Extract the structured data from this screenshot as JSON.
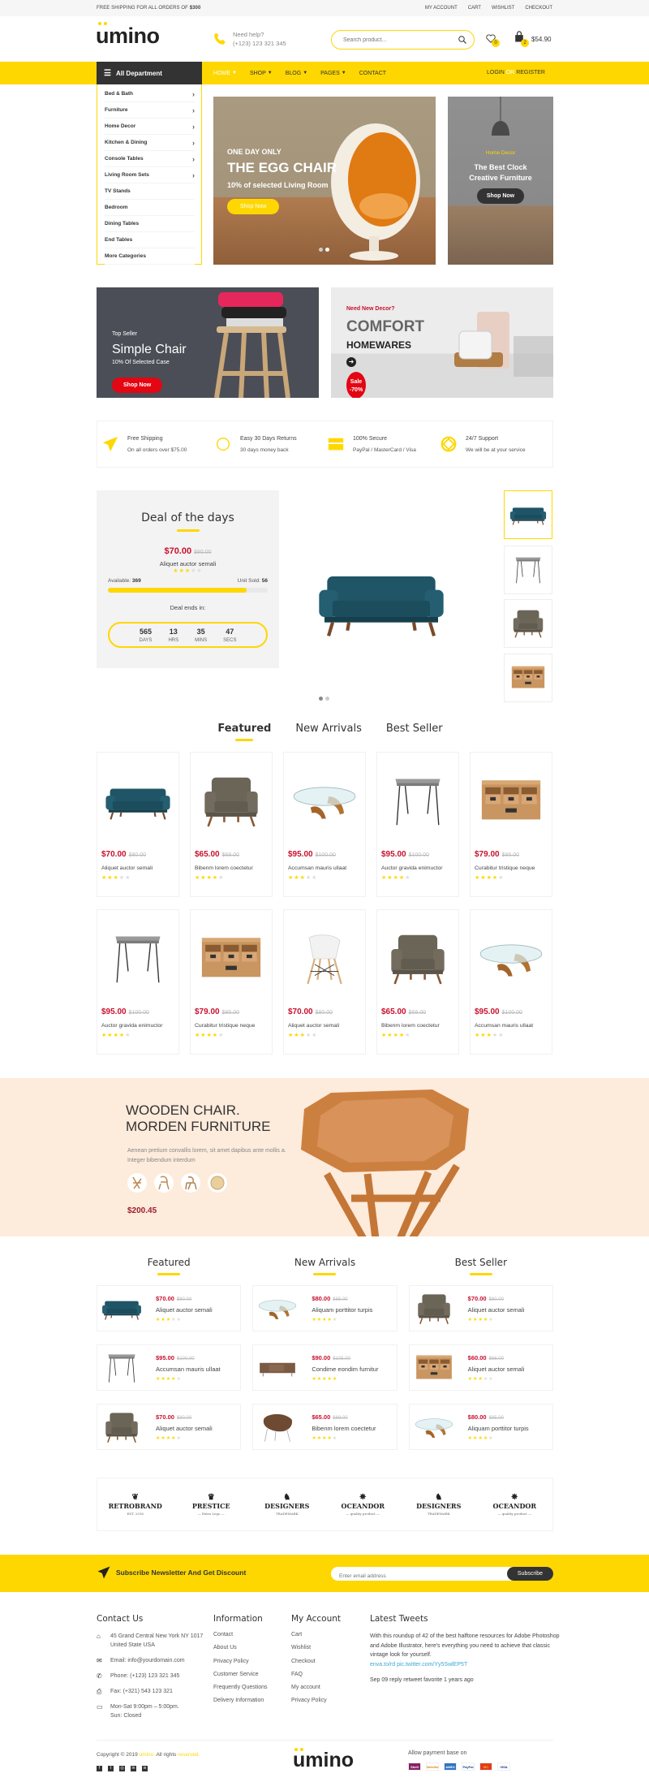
{
  "colors": {
    "accent": "#fed700",
    "price": "#c8102e",
    "dark": "#333333",
    "promo_bg": "#fdebdc"
  },
  "topbar": {
    "shipping_text": "FREE SHIPPING FOR ALL ORDERS OF",
    "shipping_amount": "$300",
    "links": [
      "MY ACCOUNT",
      "CART",
      "WISHLIST",
      "CHECKOUT"
    ]
  },
  "header": {
    "logo": "umino",
    "help_label": "Need help?",
    "phone": "(+123) 123 321 345",
    "search_placeholder": "Search product...",
    "wishlist_count": "0",
    "cart_count": "2",
    "cart_total": "$54.90"
  },
  "nav": {
    "department_label": "All Department",
    "items": [
      "HOME",
      "SHOP",
      "BLOG",
      "PAGES",
      "CONTACT"
    ],
    "active": "HOME",
    "login": "LOGIN",
    "or": "OR",
    "register": "REGISTER"
  },
  "departments": [
    {
      "label": "Bed & Bath",
      "arrow": true
    },
    {
      "label": "Furniture",
      "arrow": true
    },
    {
      "label": "Home Decor",
      "arrow": true
    },
    {
      "label": "Kitchen & Dining",
      "arrow": true
    },
    {
      "label": "Console Tables",
      "arrow": true
    },
    {
      "label": "Living Room Sets",
      "arrow": true
    },
    {
      "label": "TV Stands",
      "arrow": false
    },
    {
      "label": "Bedroom",
      "arrow": false
    },
    {
      "label": "Dining Tables",
      "arrow": false
    },
    {
      "label": "End Tables",
      "arrow": false
    },
    {
      "label": "More Categories",
      "arrow": false
    }
  ],
  "hero": {
    "eyebrow": "ONE DAY ONLY",
    "title": "THE EGG CHAIR",
    "subtitle": "10% of selected Living Room",
    "button": "Shop Now",
    "slides": 2,
    "active_slide": 2
  },
  "side_banner": {
    "eyebrow": "Home Decor",
    "title": "The Best Clock Creative Furniture",
    "button": "Shop Now"
  },
  "banners": {
    "left": {
      "eyebrow": "Top Seller",
      "title": "Simple Chair",
      "subtitle": "10% Of Selected Case",
      "button": "Shop Now"
    },
    "right": {
      "eyebrow": "Need New Decor?",
      "title": "COMFORT",
      "subtitle": "HOMEWARES",
      "sale": "Sale",
      "sale_value": "-70%"
    }
  },
  "features": [
    {
      "icon": "paper-plane-icon",
      "title": "Free Shipping",
      "text": "On all orders over $75.00"
    },
    {
      "icon": "return-icon",
      "title": "Easy 30 Days Returns",
      "text": "30 days money back"
    },
    {
      "icon": "credit-card-icon",
      "title": "100% Secure",
      "text": "PayPal / MasterCard / Visa"
    },
    {
      "icon": "lifebuoy-icon",
      "title": "24/7 Support",
      "text": "We will be at your service"
    }
  ],
  "deal": {
    "title": "Deal of the days",
    "price": "$70.00",
    "old_price": "$80.00",
    "name": "Aliquet auctor semali",
    "rating": 3,
    "available_label": "Available:",
    "available": "369",
    "sold_label": "Unit Sold:",
    "sold": "56",
    "progress": 0.87,
    "ends_label": "Deal ends in:",
    "countdown": [
      {
        "value": "565",
        "unit": "DAYS"
      },
      {
        "value": "13",
        "unit": "HRS"
      },
      {
        "value": "35",
        "unit": "MINS"
      },
      {
        "value": "47",
        "unit": "SECS"
      }
    ],
    "thumbnails": [
      "sofa",
      "side-table",
      "armchair",
      "cabinet"
    ],
    "active_thumbnail": 0
  },
  "tabs": {
    "items": [
      "Featured",
      "New Arrivals",
      "Best Seller"
    ],
    "active": 0
  },
  "products": {
    "items": [
      {
        "image": "sofa",
        "price": "$70.00",
        "old_price": "$80.00",
        "name": "Aliquet auctor semali",
        "rating": 3
      },
      {
        "image": "armchair",
        "price": "$65.00",
        "old_price": "$68.00",
        "name": "Bibenm lorem coectetur",
        "rating": 4
      },
      {
        "image": "coffee-table",
        "price": "$95.00",
        "old_price": "$100.00",
        "name": "Accumsan mauris ullaat",
        "rating": 3
      },
      {
        "image": "side-table",
        "price": "$95.00",
        "old_price": "$100.00",
        "name": "Auctor gravida enimuctor",
        "rating": 4
      },
      {
        "image": "cabinet",
        "price": "$79.00",
        "old_price": "$85.00",
        "name": "Curabitur tristique neque",
        "rating": 4
      },
      {
        "image": "side-table",
        "price": "$95.00",
        "old_price": "$100.00",
        "name": "Auctor gravida enimuctor",
        "rating": 4
      },
      {
        "image": "cabinet",
        "price": "$79.00",
        "old_price": "$85.00",
        "name": "Curabitur tristique neque",
        "rating": 4
      },
      {
        "image": "eames-chair",
        "price": "$70.00",
        "old_price": "$80.00",
        "name": "Aliquet auctor semali",
        "rating": 3
      },
      {
        "image": "armchair",
        "price": "$65.00",
        "old_price": "$68.00",
        "name": "Bibenm lorem coectetur",
        "rating": 4
      },
      {
        "image": "coffee-table",
        "price": "$95.00",
        "old_price": "$100.00",
        "name": "Accumsan mauris ullaat",
        "rating": 3
      }
    ]
  },
  "promo": {
    "title_line1": "WOODEN CHAIR.",
    "title_line2": "MORDEN FURNITURE",
    "text": "Aenean pretium convallis lorem, sit amet dapibus ante mollis a. Integer bibendum interdum",
    "price": "$200.45"
  },
  "lists": [
    {
      "title": "Featured",
      "items": [
        {
          "image": "sofa",
          "price": "$70.00",
          "old_price": "$80.00",
          "name": "Aliquet auctor semali",
          "rating": 3
        },
        {
          "image": "side-table",
          "price": "$95.00",
          "old_price": "$100.00",
          "name": "Accumsan mauris ullaat",
          "rating": 4
        },
        {
          "image": "armchair",
          "price": "$70.00",
          "old_price": "$80.00",
          "name": "Aliquet auctor semali",
          "rating": 4
        }
      ]
    },
    {
      "title": "New Arrivals",
      "items": [
        {
          "image": "coffee-table",
          "price": "$80.00",
          "old_price": "$85.00",
          "name": "Aliquam porttitor turpis",
          "rating": 4
        },
        {
          "image": "sideboard",
          "price": "$90.00",
          "old_price": "$105.00",
          "name": "Condime eondim furnitur",
          "rating": 5
        },
        {
          "image": "lounge-chair",
          "price": "$65.00",
          "old_price": "$68.00",
          "name": "Bibenm lorem coectetur",
          "rating": 4
        }
      ]
    },
    {
      "title": "Best Seller",
      "items": [
        {
          "image": "armchair",
          "price": "$70.00",
          "old_price": "$80.00",
          "name": "Aliquet auctor semali",
          "rating": 4
        },
        {
          "image": "cabinet",
          "price": "$60.00",
          "old_price": "$66.00",
          "name": "Aliquet auctor semali",
          "rating": 3
        },
        {
          "image": "coffee-table",
          "price": "$80.00",
          "old_price": "$85.00",
          "name": "Aliquam porttitor turpis",
          "rating": 4
        }
      ]
    }
  ],
  "brands": [
    {
      "name": "RETROBRAND",
      "mark": "❦",
      "tag": "EST. 2016"
    },
    {
      "name": "PRESTICE",
      "mark": "♛",
      "tag": "— Extra Logo —"
    },
    {
      "name": "DESIGNERS",
      "mark": "♞",
      "tag": "TRADEMARK"
    },
    {
      "name": "OCEANDOR",
      "mark": "✵",
      "tag": "— quality product —"
    },
    {
      "name": "DESIGNERS",
      "mark": "♞",
      "tag": "TRADEMARK"
    },
    {
      "name": "OCEANDOR",
      "mark": "✵",
      "tag": "— quality product —"
    }
  ],
  "newsletter": {
    "label": "Subscribe Newsletter And Get Discount",
    "placeholder": "Enter email address",
    "button": "Subscribe"
  },
  "footer": {
    "contact": {
      "title": "Contact Us",
      "address": "45 Grand Central New York NY 1017 United State USA",
      "email_label": "Email:",
      "email": "info@yourdomain.com",
      "phone_label": "Phone:",
      "phone": "(+123) 123 321 345",
      "fax_label": "Fax:",
      "fax": "(+321) 543 123 321",
      "hours": "Mon-Sat 9:00pm – 5:00pm.",
      "closed": "Sun: Closed"
    },
    "information": {
      "title": "Information",
      "links": [
        "Contact",
        "About Us",
        "Privacy Policy",
        "Customer Service",
        "Frequently Questions",
        "Delivery Information"
      ]
    },
    "account": {
      "title": "My Account",
      "links": [
        "Cart",
        "Wishlist",
        "Checkout",
        "FAQ",
        "My account",
        "Privacy Policy"
      ]
    },
    "tweets": {
      "title": "Latest Tweets",
      "text": "With this roundup of 42 of the best halftone resources for Adobe Photoshop and Adobe Illustrator, here's everything you need to achieve that classic vintage look for yourself.",
      "link": "enva.to/rd pic.twitter.com/Yy5SwlEP5T",
      "meta": "Sep 09 reply retweet favorite 1 years ago"
    },
    "copyright_prefix": "Copyright © 2019",
    "copyright_brand": "umino.",
    "copyright_mid": "All rights",
    "copyright_suffix": "reserved.",
    "social": [
      "facebook-icon",
      "twitter-icon",
      "instagram-icon",
      "linkedin-icon",
      "rss-icon"
    ],
    "logo": "umino",
    "payment_label": "Allow payment base on",
    "payments": [
      {
        "name": "Skrill",
        "color": "#862165",
        "fg": "#ffffff"
      },
      {
        "name": "Neteller",
        "color": "#ffffff",
        "fg": "#d18a00"
      },
      {
        "name": "AMEX",
        "color": "#2f73c4",
        "fg": "#ffffff"
      },
      {
        "name": "PayPal",
        "color": "#ffffff",
        "fg": "#1e3f8a"
      },
      {
        "name": "MC",
        "color": "#e23a1e",
        "fg": "#ffb400"
      },
      {
        "name": "VISA",
        "color": "#ffffff",
        "fg": "#1a2e8c"
      }
    ]
  }
}
